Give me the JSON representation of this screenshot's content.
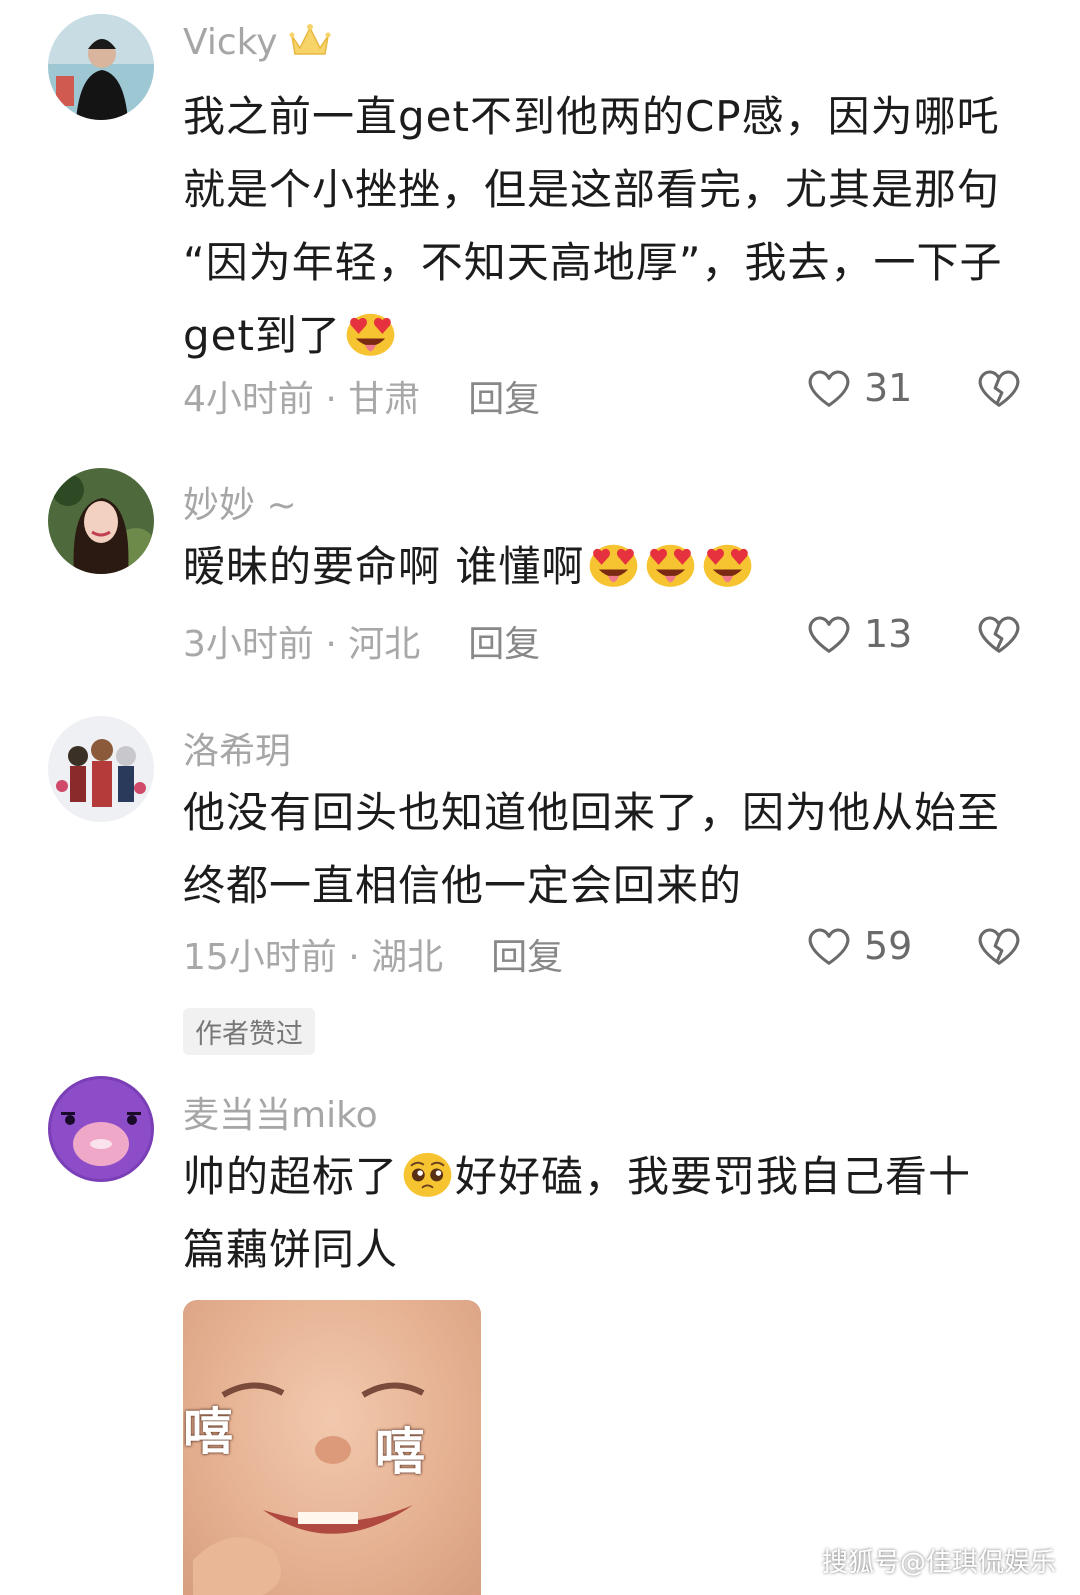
{
  "comments": [
    {
      "username": "Vicky",
      "text_lines": [
        "我之前一直get不到他两的CP感，因为哪吒",
        "就是个小挫挫，但是这部看完，尤其是那句",
        "“因为年轻，不知天高地厚”，我去，一下子",
        "get到了"
      ],
      "time_location": "4小时前 · 甘肃",
      "reply_label": "回复",
      "likes": "31"
    },
    {
      "username": "妙妙 ~",
      "text": "暧昧的要命啊 谁懂啊",
      "time_location": "3小时前 · 河北",
      "reply_label": "回复",
      "likes": "13"
    },
    {
      "username": "洛希玥",
      "text_lines": [
        "他没有回头也知道他回来了，因为他从始至",
        "终都一直相信他一定会回来的"
      ],
      "time_location": "15小时前 · 湖北",
      "reply_label": "回复",
      "likes": "59",
      "badge": "作者赞过"
    },
    {
      "username": "麦当当miko",
      "text_line1_a": "帅的超标了",
      "text_line1_b": "好好磕，我要罚我自己看十",
      "text_line2": "篇藕饼同人",
      "sticker_chars": [
        "嘻",
        "嘻"
      ]
    }
  ],
  "watermark": "搜狐号@佳琪侃娱乐",
  "icons": {
    "crown": "crown-icon",
    "heart_eyes": "heart-eyes-emoji",
    "pleading": "pleading-face-emoji",
    "like": "heart-outline-icon",
    "dislike": "broken-heart-icon"
  },
  "colors": {
    "username": "#a6a6a6",
    "body_text": "#1c1c1c",
    "meta": "#a8a8a8"
  }
}
